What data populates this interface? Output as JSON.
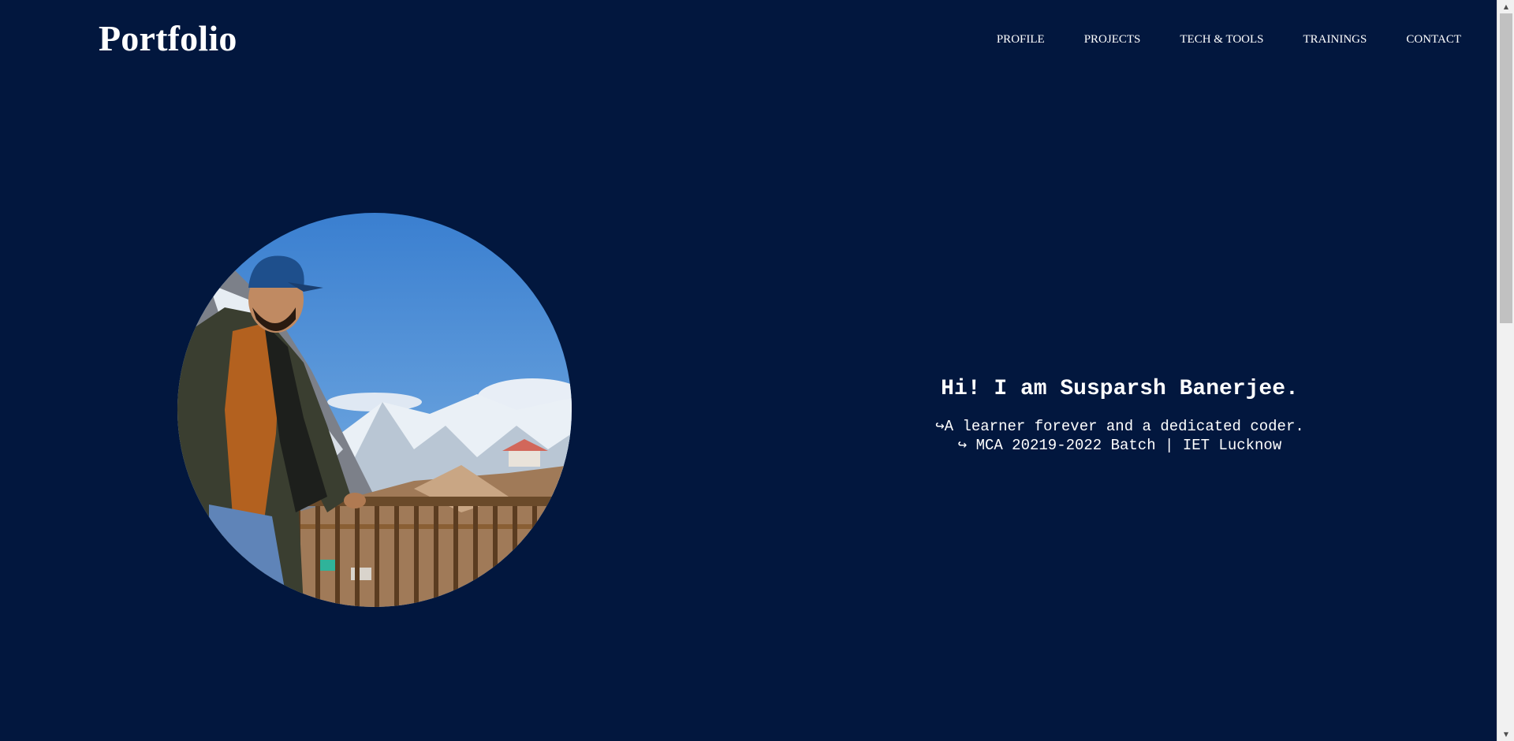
{
  "header": {
    "brand": "Portfolio",
    "nav": [
      {
        "label": "PROFILE"
      },
      {
        "label": "PROJECTS"
      },
      {
        "label": "TECH & TOOLS"
      },
      {
        "label": "TRAININGS"
      },
      {
        "label": "CONTACT"
      }
    ]
  },
  "hero": {
    "title": "Hi! I am Susparsh Banerjee.",
    "line1": "↪A learner forever and a dedicated coder.",
    "line2": "↪ MCA 20219-2022 Batch | IET Lucknow",
    "photo_icon": "profile-photo"
  },
  "scrollbar": {
    "up_arrow": "▲",
    "down_arrow": "▼"
  },
  "colors": {
    "background": "#02173e",
    "text": "#ffffff"
  }
}
